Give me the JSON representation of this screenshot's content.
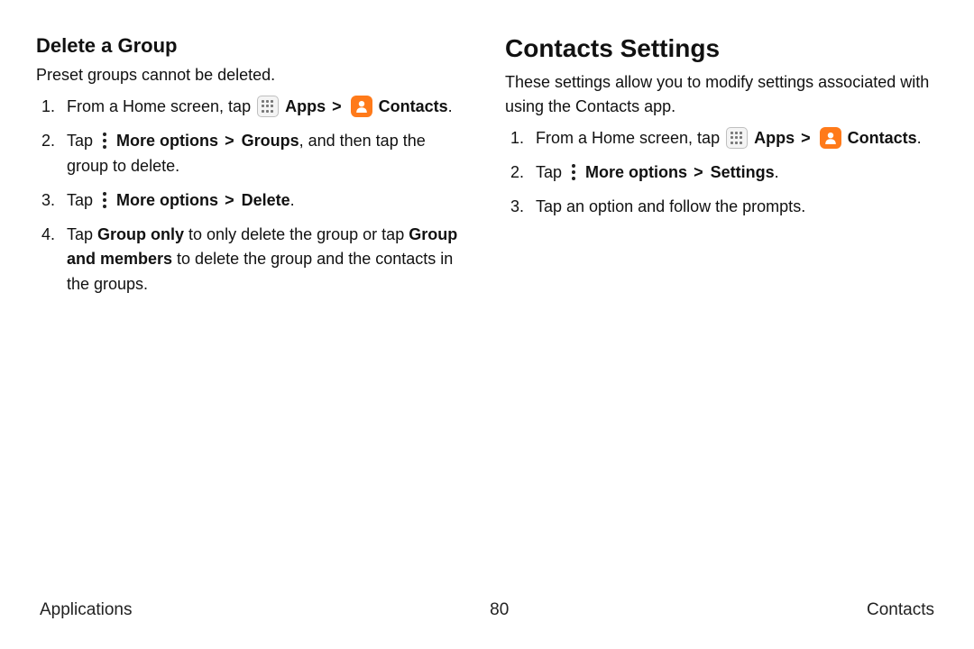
{
  "left": {
    "heading": "Delete a Group",
    "lead": "Preset groups cannot be deleted.",
    "steps": {
      "s1_a": "From a Home screen, tap ",
      "s1_apps": "Apps",
      "s1_chev": ">",
      "s1_contacts": "Contacts",
      "s1_end": ".",
      "s2_a": "Tap ",
      "s2_more": "More options",
      "s2_chev": ">",
      "s2_groups": "Groups",
      "s2_b": ", and then tap the group to delete.",
      "s3_a": "Tap ",
      "s3_more": "More options",
      "s3_chev": ">",
      "s3_delete": "Delete",
      "s3_end": ".",
      "s4_a": "Tap ",
      "s4_go": "Group only",
      "s4_b": " to only delete the group or tap ",
      "s4_gm": "Group and members",
      "s4_c": " to delete the group and the contacts in the groups."
    }
  },
  "right": {
    "heading": "Contacts Settings",
    "lead": "These settings allow you to modify settings associated with using the Contacts app.",
    "steps": {
      "s1_a": "From a Home screen, tap ",
      "s1_apps": "Apps",
      "s1_chev": ">",
      "s1_contacts": "Contacts",
      "s1_end": ".",
      "s2_a": "Tap ",
      "s2_more": "More options",
      "s2_chev": ">",
      "s2_settings": "Settings",
      "s2_end": ".",
      "s3": "Tap an option and follow the prompts."
    }
  },
  "footer": {
    "left": "Applications",
    "center": "80",
    "right": "Contacts"
  },
  "icons": {
    "apps": "apps-icon",
    "contacts": "contacts-icon",
    "more": "more-options-icon"
  }
}
